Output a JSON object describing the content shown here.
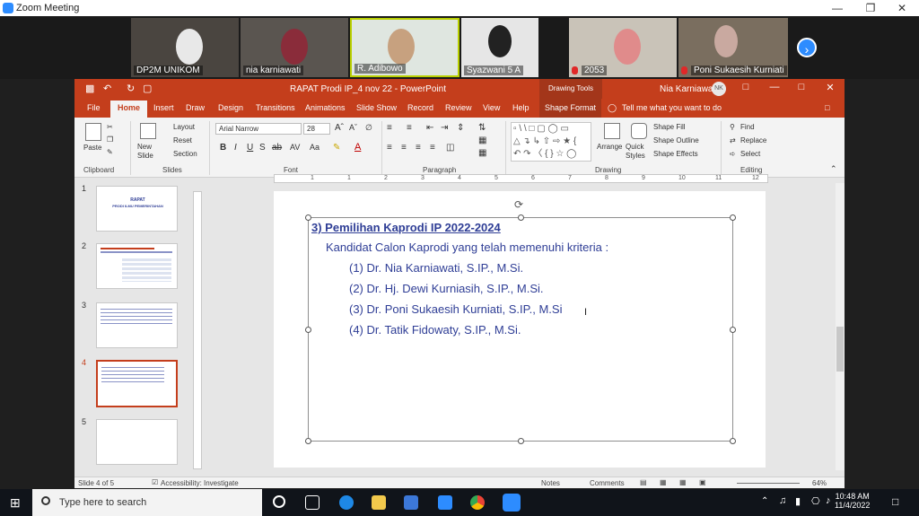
{
  "zoom": {
    "title": "Zoom Meeting"
  },
  "participants": [
    {
      "name": "DP2M UNIKOM",
      "muted": false
    },
    {
      "name": "nia karniawati",
      "muted": false
    },
    {
      "name": "R. Adibowo",
      "muted": false
    },
    {
      "name": "Syazwani 5 A",
      "muted": false
    },
    {
      "name": "2053",
      "muted": true
    },
    {
      "name": "Poni Sukaesih Kurniati",
      "muted": true
    }
  ],
  "ppt": {
    "title": "RAPAT Prodi IP_4 nov 22  -  PowerPoint",
    "drawing_tools": "Drawing Tools",
    "user": "Nia Karniawati",
    "avatar": "NK",
    "tabs": [
      "File",
      "Home",
      "Insert",
      "Draw",
      "Design",
      "Transitions",
      "Animations",
      "Slide Show",
      "Record",
      "Review",
      "View",
      "Help",
      "Shape Format"
    ],
    "tell_me": "Tell me what you want to do",
    "ribbon": {
      "paste": "Paste",
      "clipboard": "Clipboard",
      "new_slide": "New Slide",
      "layout": "Layout",
      "reset": "Reset",
      "section": "Section",
      "slides": "Slides",
      "font_name": "Arial Narrow",
      "font_size": "28",
      "font": "Font",
      "paragraph": "Paragraph",
      "arrange": "Arrange",
      "quick_styles": "Quick Styles",
      "shape_fill": "Shape Fill",
      "shape_outline": "Shape Outline",
      "shape_effects": "Shape Effects",
      "drawing": "Drawing",
      "find": "Find",
      "replace": "Replace",
      "select": "Select",
      "editing": "Editing"
    },
    "slide": {
      "heading": "3) Pemilihan Kaprodi IP 2022-2024",
      "subheading": "Kandidat Calon Kaprodi yang telah memenuhi kriteria :",
      "candidates": [
        "(1)  Dr. Nia Karniawati, S.IP., M.Si.",
        "(2)  Dr. Hj. Dewi Kurniasih, S.IP., M.Si.",
        "(3)  Dr. Poni Sukaesih Kurniati, S.IP., M.Si",
        "(4)  Dr. Tatik Fidowaty, S.IP., M.Si."
      ]
    },
    "thumbnails": [
      "1",
      "2",
      "3",
      "4",
      "5"
    ],
    "thumb1_title": "RAPAT",
    "thumb1_sub": "PRODI ILMU PEMERINTAHAN",
    "status": {
      "slide_of": "Slide 4 of 5",
      "accessibility": "Accessibility: Investigate",
      "notes": "Notes",
      "comments": "Comments",
      "zoom": "64%"
    }
  },
  "taskbar": {
    "search_placeholder": "Type here to search",
    "time": "10:48 AM",
    "date": "11/4/2022"
  }
}
